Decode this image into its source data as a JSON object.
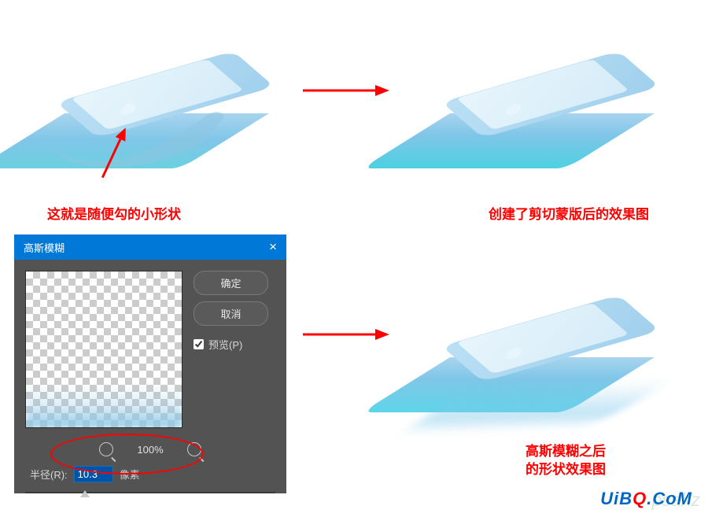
{
  "captions": {
    "c1": "这就是随便勾的小形状",
    "c2": "创建了剪切蒙版后的效果图",
    "c3_line1": "高斯模糊之后",
    "c3_line2": "的形状效果图"
  },
  "dialog": {
    "title": "高斯模糊",
    "close": "×",
    "ok": "确定",
    "cancel": "取消",
    "preview": "预览(P)",
    "zoom": "100%",
    "radius_label": "半径(R):",
    "radius_value": "10.3",
    "radius_unit": "像素"
  },
  "watermark": {
    "text_prefix": "UiB",
    "text_q": "Q",
    "text_suffix": ".CoM"
  }
}
